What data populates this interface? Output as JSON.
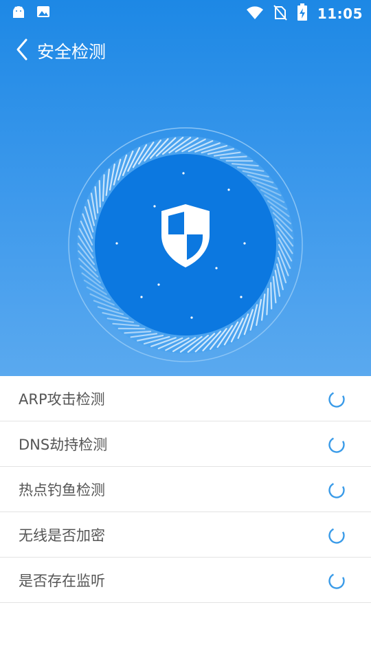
{
  "status_bar": {
    "time": "11:05",
    "left_icons": [
      "android-icon",
      "image-icon"
    ],
    "right_icons": [
      "wifi-icon",
      "no-sim-icon",
      "battery-charging-icon"
    ]
  },
  "header": {
    "title": "安全检测",
    "back_icon": "chevron-left-icon"
  },
  "scanner": {
    "icon": "shield-icon",
    "colors": {
      "inner": "#0c78e0",
      "ring": "#4ea6f0",
      "ticks": "#cfe6fb"
    }
  },
  "checks": [
    {
      "label": "ARP攻击检测",
      "status_icon": "loading-spinner-icon"
    },
    {
      "label": "DNS劫持检测",
      "status_icon": "loading-spinner-icon"
    },
    {
      "label": "热点钓鱼检测",
      "status_icon": "loading-spinner-icon"
    },
    {
      "label": "无线是否加密",
      "status_icon": "loading-spinner-icon"
    },
    {
      "label": "是否存在监听",
      "status_icon": "loading-spinner-icon"
    }
  ],
  "colors": {
    "primary": "#1d88e5",
    "spinner": "#3a9be8",
    "divider": "#e3e3e3",
    "text": "#555555"
  }
}
